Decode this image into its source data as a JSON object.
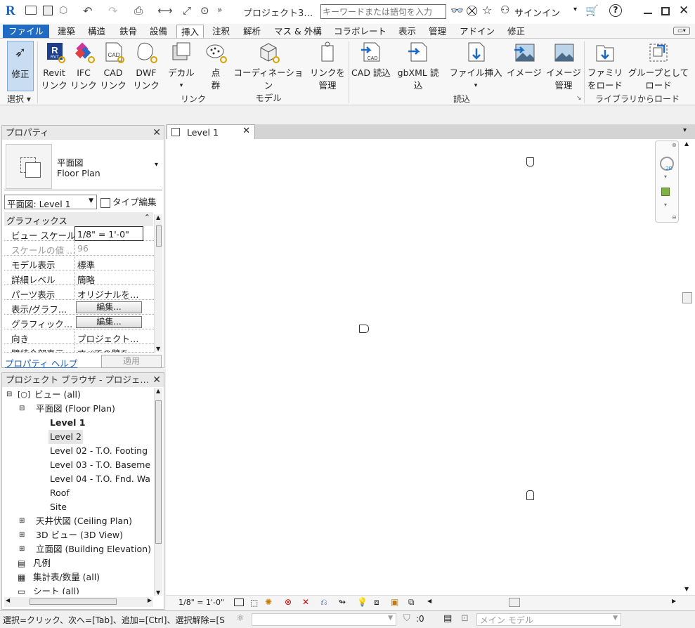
{
  "app": {
    "logo": "R",
    "title": "プロジェクト3…",
    "search_placeholder": "キーワードまたは語句を入力",
    "signin": "サインイン"
  },
  "ribbon_tabs": [
    "ファイル",
    "建築",
    "構造",
    "鉄骨",
    "設備",
    "挿入",
    "注釈",
    "解析",
    "マス & 外構",
    "コラボレート",
    "表示",
    "管理",
    "アドイン",
    "修正"
  ],
  "ribbon": {
    "modify": "修正",
    "select_label": "選択 ▾",
    "link_buttons": [
      {
        "l1": "Revit",
        "l2": "リンク"
      },
      {
        "l1": "IFC",
        "l2": "リンク"
      },
      {
        "l1": "CAD",
        "l2": "リンク"
      },
      {
        "l1": "DWF",
        "l2": "リンク"
      },
      {
        "l1": "デカル",
        "l2": "▾"
      },
      {
        "l1": "点",
        "l2": "群"
      },
      {
        "l1": "コーディネーション",
        "l2": "モデル"
      },
      {
        "l1": "リンクを",
        "l2": "管理"
      }
    ],
    "link_panel": "リンク",
    "import_buttons": [
      {
        "l1": "CAD 読込",
        "l2": ""
      },
      {
        "l1": "gbXML 読込",
        "l2": ""
      },
      {
        "l1": "ファイル挿入",
        "l2": "▾"
      },
      {
        "l1": "イメージ",
        "l2": ""
      },
      {
        "l1": "イメージ",
        "l2": "管理"
      }
    ],
    "import_panel": "読込",
    "library_buttons": [
      {
        "l1": "ファミリ",
        "l2": "をロード"
      },
      {
        "l1": "グループとして",
        "l2": "ロード"
      }
    ],
    "library_panel": "ライブラリからロード"
  },
  "properties": {
    "title": "プロパティ",
    "type_line1": "平面図",
    "type_line2": "Floor Plan",
    "selector": "平面図: Level 1",
    "type_edit": "タイプ編集",
    "section": "グラフィックス",
    "rows": [
      {
        "k": "ビュー スケール",
        "v": "1/8\" = 1'-0\""
      },
      {
        "k": "スケールの値 …",
        "v": "96"
      },
      {
        "k": "モデル表示",
        "v": "標準"
      },
      {
        "k": "詳細レベル",
        "v": "簡略"
      },
      {
        "k": "パーツ表示",
        "v": "オリジナルを…"
      },
      {
        "k": "表示/グラフ…",
        "v": "編集..."
      },
      {
        "k": "グラフィック…",
        "v": "編集..."
      },
      {
        "k": "向き",
        "v": "プロジェクト…"
      },
      {
        "k": "壁結合部表示",
        "v": "すべての壁を…"
      }
    ],
    "help": "プロパティ ヘルプ",
    "apply": "適用"
  },
  "browser": {
    "title": "プロジェクト ブラウザ - プロジェ…",
    "items": [
      {
        "t": "ビュー (all)"
      },
      {
        "t": "平面図 (Floor Plan)"
      },
      {
        "t": "Level 1"
      },
      {
        "t": "Level 2"
      },
      {
        "t": "Level 02 - T.O. Footing"
      },
      {
        "t": "Level 03 - T.O. Basemen"
      },
      {
        "t": "Level 04 - T.O. Fnd. Wal"
      },
      {
        "t": "Roof"
      },
      {
        "t": "Site"
      },
      {
        "t": "天井伏図 (Ceiling Plan)"
      },
      {
        "t": "3D ビュー (3D View)"
      },
      {
        "t": "立面図 (Building Elevation)"
      },
      {
        "t": "凡例"
      },
      {
        "t": "集計表/数量 (all)"
      },
      {
        "t": "シート (all)"
      }
    ]
  },
  "view": {
    "tab": "Level 1",
    "scale": "1/8\" = 1'-0\""
  },
  "status": {
    "hint": "選択=クリック、次へ=[Tab]、追加=[Ctrl]、選択解除=[S",
    "filter_count": ":0",
    "model": "メイン モデル"
  }
}
